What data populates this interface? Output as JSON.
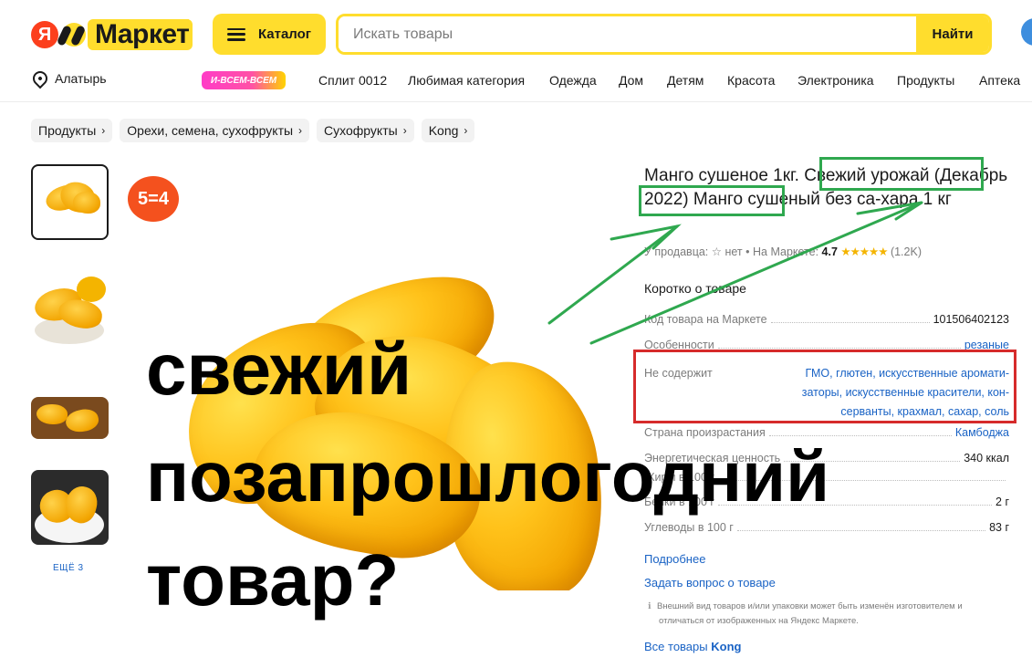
{
  "header": {
    "logo_ya": "Я",
    "logo_text": "Маркет",
    "catalog_label": "Каталог",
    "search_placeholder": "Искать товары",
    "search_button": "Найти"
  },
  "nav": {
    "location": "Алатырь",
    "promo": "И-ВСЕМ-ВСЕМ",
    "items": [
      "Сплит 0012",
      "Любимая категория",
      "Одежда",
      "Дом",
      "Детям",
      "Красота",
      "Электроника",
      "Продукты",
      "Аптека"
    ]
  },
  "breadcrumbs": [
    "Продукты",
    "Орехи, семена, сухофрукты",
    "Сухофрукты",
    "Kong"
  ],
  "gallery": {
    "badge": "5=4",
    "more_label": "ЕЩЁ 3"
  },
  "product": {
    "title_part1": "Манго сушеное 1кг.",
    "title_part2": "Свежий урожай",
    "title_part3": "(Декабрь 2022)",
    "title_part4": "Манго сушеный без са-хара 1 кг",
    "seller_label": "У продавца:",
    "seller_star": "☆",
    "seller_value": "нет",
    "market_label": "• На Маркете:",
    "rating": "4.7",
    "stars": "★★★★★",
    "reviews": "(1.2K)",
    "short_label": "Коротко о товаре",
    "specs": {
      "code_k": "Код товара на Маркете",
      "code_v": "101506402123",
      "feat_k": "Особенности",
      "feat_v": "резаные",
      "free_k": "Не содержит",
      "free_v": "ГМО, глютен, искусственные аромати-заторы, искусственные красители, кон-серванты, крахмал, сахар, соль",
      "country_k": "Страна произрастания",
      "country_v": "Камбоджа",
      "energy_k": "Энергетическая ценность",
      "energy_v": "340 ккал",
      "fat_k": "Жиры в 100 г",
      "fat_v": "",
      "protein_k": "Белки в 100 г",
      "protein_v": "2 г",
      "carb_k": "Углеводы в 100 г",
      "carb_v": "83 г"
    },
    "more_link": "Подробнее",
    "ask_link": "Задать вопрос о товаре",
    "note_line1": "Внешний вид товаров и/или упаковки может быть изменён изготовителем и",
    "note_line2": "отличаться от изображенных на Яндекс Маркете.",
    "all_goods": "Все товары",
    "brand": "Kong"
  },
  "overlay": {
    "line1": "свежий",
    "line2": "позапрошлогодний",
    "line3": "товар?"
  },
  "annotation_colors": {
    "green": "#2fa84f",
    "red": "#d62b2b"
  }
}
